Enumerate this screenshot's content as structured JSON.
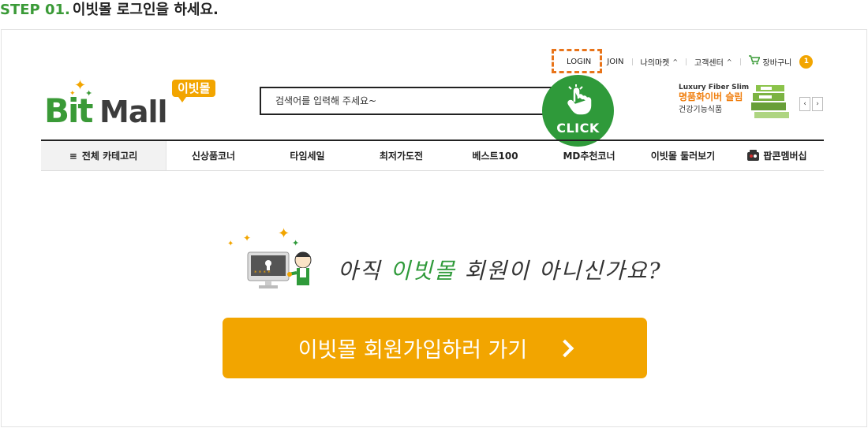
{
  "step": {
    "number": "STEP 01.",
    "description": "이빗몰 로그인을 하세요."
  },
  "util_nav": {
    "login": "LOGIN",
    "join": "JOIN",
    "my_market": "나의마켓",
    "customer_center": "고객센터",
    "cart": "장바구니",
    "cart_count": "1"
  },
  "logo": {
    "bubble": "이빗몰",
    "b_text": "Bit",
    "mall_text": "Mall"
  },
  "search": {
    "placeholder": "검색어를 입력해 주세요~"
  },
  "click_badge": {
    "label": "CLICK"
  },
  "promo": {
    "en_title": "Luxury Fiber Slim",
    "kr_title": "명품화이버 슬림",
    "subtitle": "건강기능식품",
    "prev": "‹",
    "next": "›"
  },
  "category_nav": {
    "all_label": "전체 카테고리",
    "items": [
      "신상품코너",
      "타임세일",
      "최저가도전",
      "베스트100",
      "MD추천코너",
      "이빗몰 둘러보기"
    ],
    "popcorn": "팝콘멤버십"
  },
  "headline": {
    "part1": "아직 ",
    "accent": "이빗몰",
    "part2": " 회원이 아니신가요?"
  },
  "join_button": {
    "label": "이빗몰 회원가입하러 가기"
  },
  "colors": {
    "brand_green": "#3a9a37",
    "brand_orange": "#f2a500",
    "highlight_orange": "#e8741a"
  }
}
